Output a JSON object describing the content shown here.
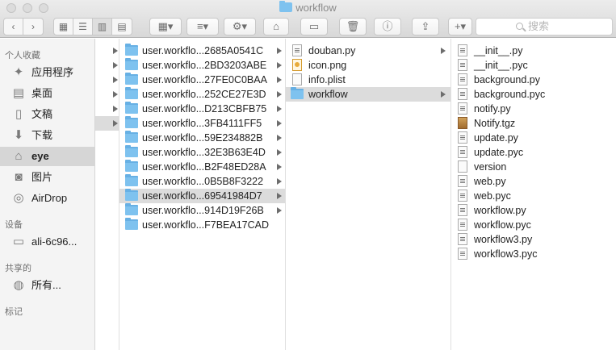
{
  "window": {
    "title": "workflow"
  },
  "toolbar": {
    "back": "‹",
    "forward": "›",
    "search_placeholder": "搜索"
  },
  "sidebar": {
    "favorites_header": "个人收藏",
    "favorites": [
      {
        "label": "应用程序",
        "icon": "applications-icon"
      },
      {
        "label": "桌面",
        "icon": "desktop-icon"
      },
      {
        "label": "文稿",
        "icon": "documents-icon"
      },
      {
        "label": "下载",
        "icon": "downloads-icon"
      },
      {
        "label": "eye",
        "icon": "home-icon"
      },
      {
        "label": "图片",
        "icon": "pictures-icon"
      },
      {
        "label": "AirDrop",
        "icon": "airdrop-icon"
      }
    ],
    "devices_header": "设备",
    "devices": [
      {
        "label": "ali-6c96...",
        "icon": "computer-icon"
      }
    ],
    "shared_header": "共享的",
    "shared": [
      {
        "label": "所有...",
        "icon": "network-icon"
      }
    ],
    "tags_header": "标记"
  },
  "column1": {
    "items": [
      "user.workflo...2685A0541C",
      "user.workflo...2BD3203ABE",
      "user.workflo...27FE0C0BAA",
      "user.workflo...252CE27E3D",
      "user.workflo...D213CBFB75",
      "user.workflo...3FB4111FF5",
      "user.workflo...59E234882B",
      "user.workflo...32E3B63E4D",
      "user.workflo...B2F48ED28A",
      "user.workflo...0B5B8F3222",
      "user.workflo...69541984D7",
      "user.workflo...914D19F26B",
      "user.workflo...F7BEA17CAD"
    ]
  },
  "column2": {
    "items": [
      "douban.py",
      "icon.png",
      "info.plist",
      "workflow"
    ]
  },
  "column3": {
    "items": [
      "__init__.py",
      "__init__.pyc",
      "background.py",
      "background.pyc",
      "notify.py",
      "Notify.tgz",
      "update.py",
      "update.pyc",
      "version",
      "web.py",
      "web.pyc",
      "workflow.py",
      "workflow.pyc",
      "workflow3.py",
      "workflow3.pyc"
    ]
  }
}
